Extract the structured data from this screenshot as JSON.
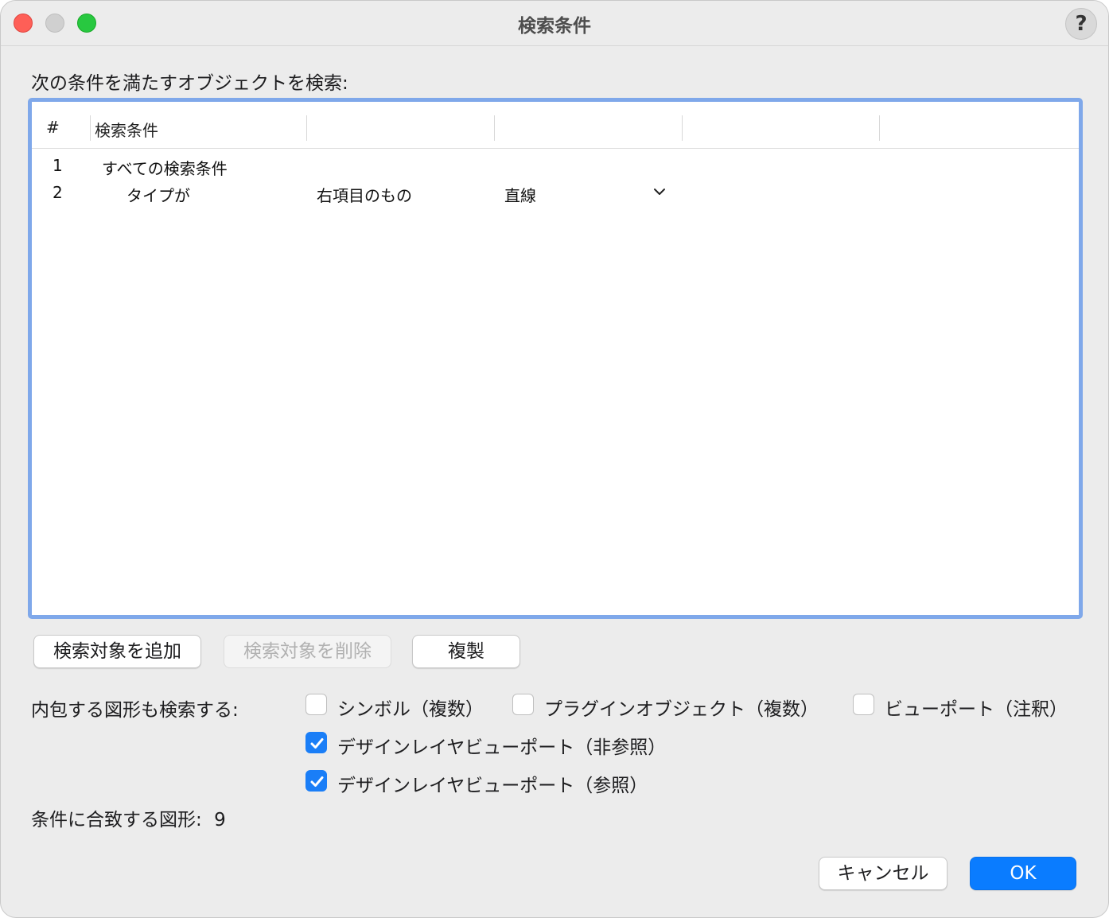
{
  "window": {
    "title": "検索条件",
    "help_label": "?"
  },
  "prompt": "次の条件を満たすオブジェクトを検索:",
  "table": {
    "headers": [
      "#",
      "検索条件",
      "",
      "",
      "",
      ""
    ],
    "rows": [
      {
        "num": "1",
        "criterion": "すべての検索条件",
        "operator": "",
        "value": ""
      },
      {
        "num": "2",
        "criterion": "タイプが",
        "operator": "右項目のもの",
        "value": "直線"
      }
    ]
  },
  "buttons": {
    "add": "検索対象を追加",
    "remove": "検索対象を削除",
    "duplicate": "複製",
    "cancel": "キャンセル",
    "ok": "OK"
  },
  "include_label": "内包する図形も検索する:",
  "checkboxes": [
    {
      "label": "シンボル（複数）",
      "checked": false
    },
    {
      "label": "プラグインオブジェクト（複数）",
      "checked": false
    },
    {
      "label": "ビューポート（注釈）",
      "checked": false
    },
    {
      "label": "デザインレイヤビューポート（非参照）",
      "checked": true
    },
    {
      "label": "デザインレイヤビューポート（参照）",
      "checked": true
    }
  ],
  "match_label": "条件に合致する図形:",
  "match_count": "9",
  "colors": {
    "accent": "#0a7cff",
    "table_focus": "#7fa8ea",
    "checkbox_checked": "#1a7ef7"
  }
}
